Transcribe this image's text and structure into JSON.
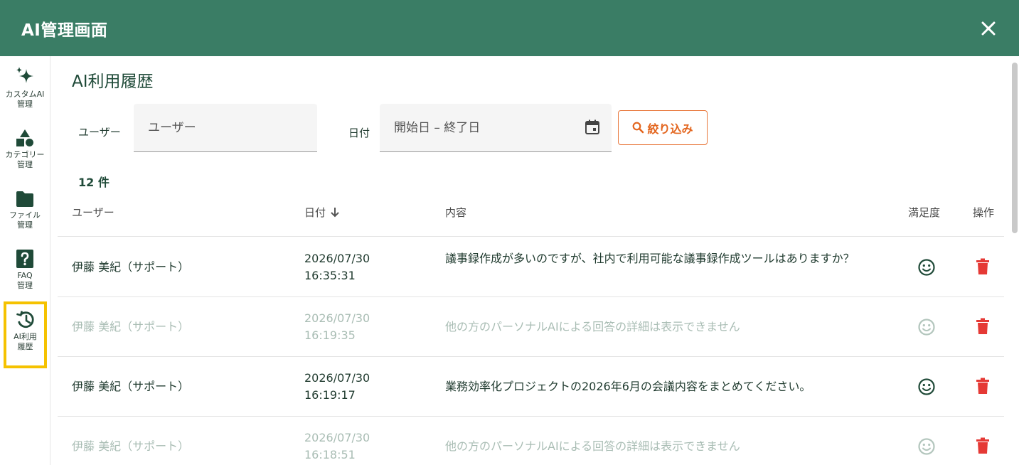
{
  "header": {
    "title": "AI管理画面"
  },
  "sidebar": {
    "items": [
      {
        "label": "カスタムAI\n管理",
        "icon": "sparkle-icon"
      },
      {
        "label": "カテゴリー\n管理",
        "icon": "shapes-icon"
      },
      {
        "label": "ファイル\n管理",
        "icon": "folder-icon"
      },
      {
        "label": "FAQ\n管理",
        "icon": "question-icon"
      },
      {
        "label": "AI利用\n履歴",
        "icon": "history-icon",
        "active": true
      }
    ]
  },
  "page": {
    "title": "AI利用履歴"
  },
  "filters": {
    "user_label": "ユーザー",
    "user_placeholder": "ユーザー",
    "date_label": "日付",
    "date_placeholder": "開始日 – 終了日",
    "filter_button": "絞り込み"
  },
  "count": "12 件",
  "table": {
    "headers": {
      "user": "ユーザー",
      "date": "日付",
      "content": "内容",
      "satisfaction": "満足度",
      "action": "操作"
    },
    "rows": [
      {
        "user": "伊藤 美紀（サポート）",
        "date": "2026/07/30\n16:35:31",
        "content": "議事録作成が多いのですが、社内で利用可能な議事録作成ツールはありますか？",
        "muted": false
      },
      {
        "user": "伊藤 美紀（サポート）",
        "date": "2026/07/30\n16:19:35",
        "content": "他の方のパーソナルAIによる回答の詳細は表示できません",
        "muted": true
      },
      {
        "user": "伊藤 美紀（サポート）",
        "date": "2026/07/30\n16:19:17",
        "content": "業務効率化プロジェクトの2026年6月の会議内容をまとめてください。",
        "muted": false
      },
      {
        "user": "伊藤 美紀（サポート）",
        "date": "2026/07/30\n16:18:51",
        "content": "他の方のパーソナルAIによる回答の詳細は表示できません",
        "muted": true
      }
    ]
  },
  "colors": {
    "header": "#3a7d65",
    "accent": "#e3651e",
    "delete": "#e53935",
    "active_outline": "#f5c200",
    "text_dark": "#1f4a38"
  }
}
